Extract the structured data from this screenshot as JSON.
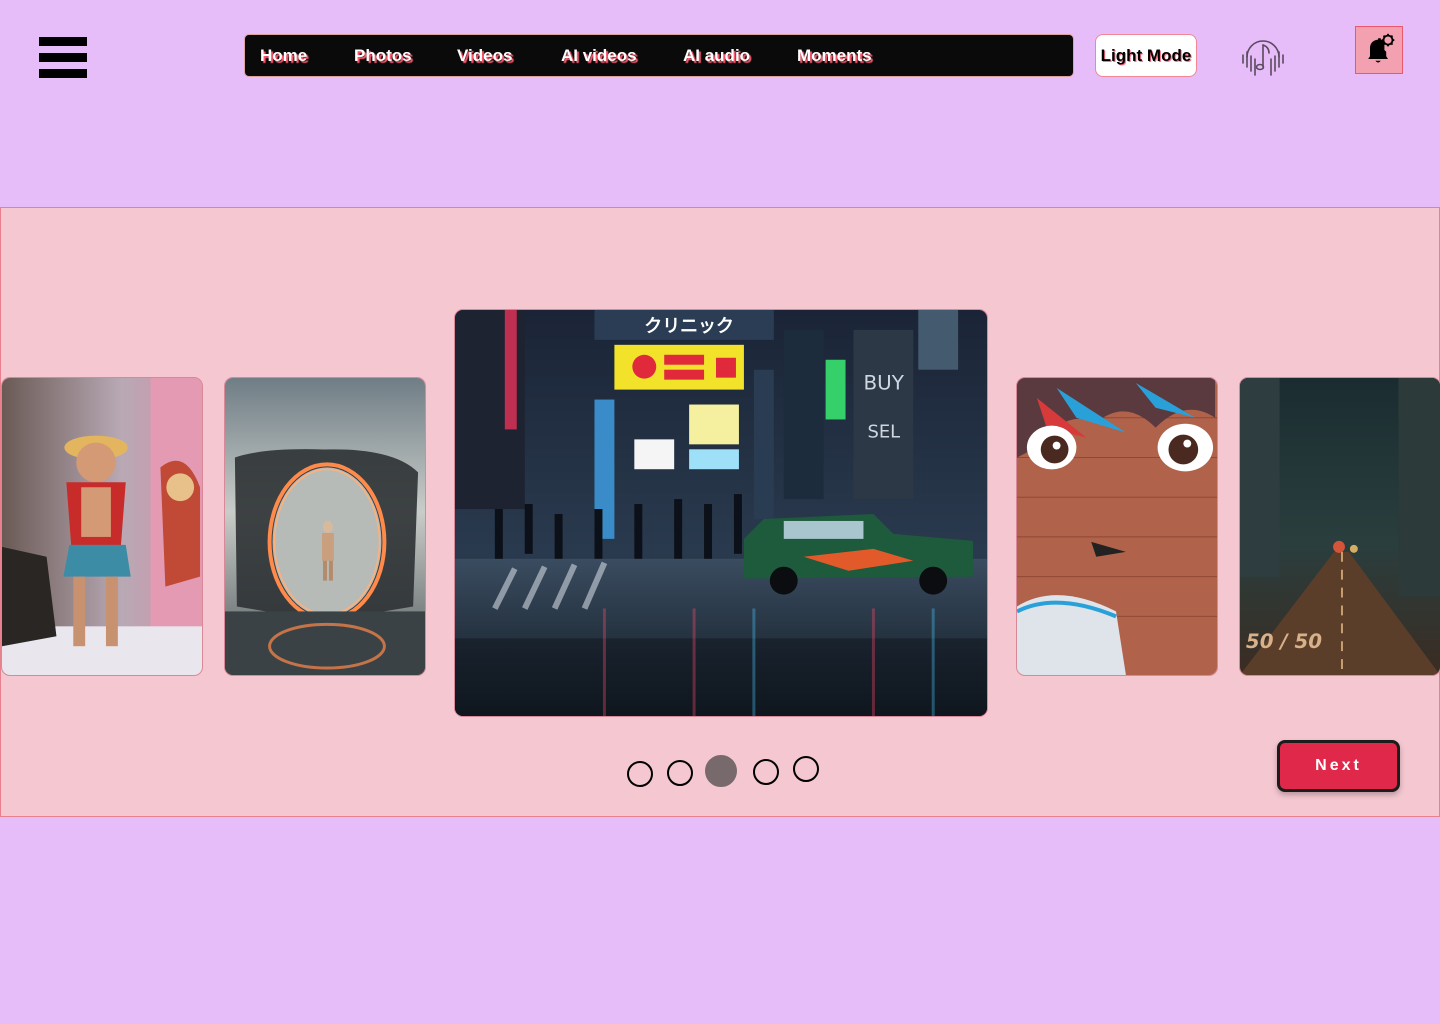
{
  "header": {
    "menu_icon": "hamburger-menu-icon",
    "nav": [
      "Home",
      "Photos",
      "Videos",
      "AI videos",
      "AI audio",
      "Moments"
    ],
    "mode_button": "Light Mode",
    "audio_icon": "music-note-icon",
    "notification_icon": "bell-settings-icon"
  },
  "carousel": {
    "slides": [
      {
        "name": "anime-figures-photo",
        "description": "Anime action figures"
      },
      {
        "name": "portal-ring-photo",
        "description": "Astronaut in glowing ring portal"
      },
      {
        "name": "tokyo-night-street-photo",
        "description": "Rainy neon Tokyo street"
      },
      {
        "name": "anime-mural-photo",
        "description": "Anime face brick mural"
      },
      {
        "name": "night-road-photo",
        "description": "Empty city road at night"
      }
    ],
    "indicators_count": 5,
    "active_index": 2,
    "next_label": "Next"
  },
  "colors": {
    "page_bg": "#e6bdf8",
    "carousel_bg": "#f5c7d1",
    "accent": "#e0294a",
    "nav_bg": "#0a0a0a"
  }
}
